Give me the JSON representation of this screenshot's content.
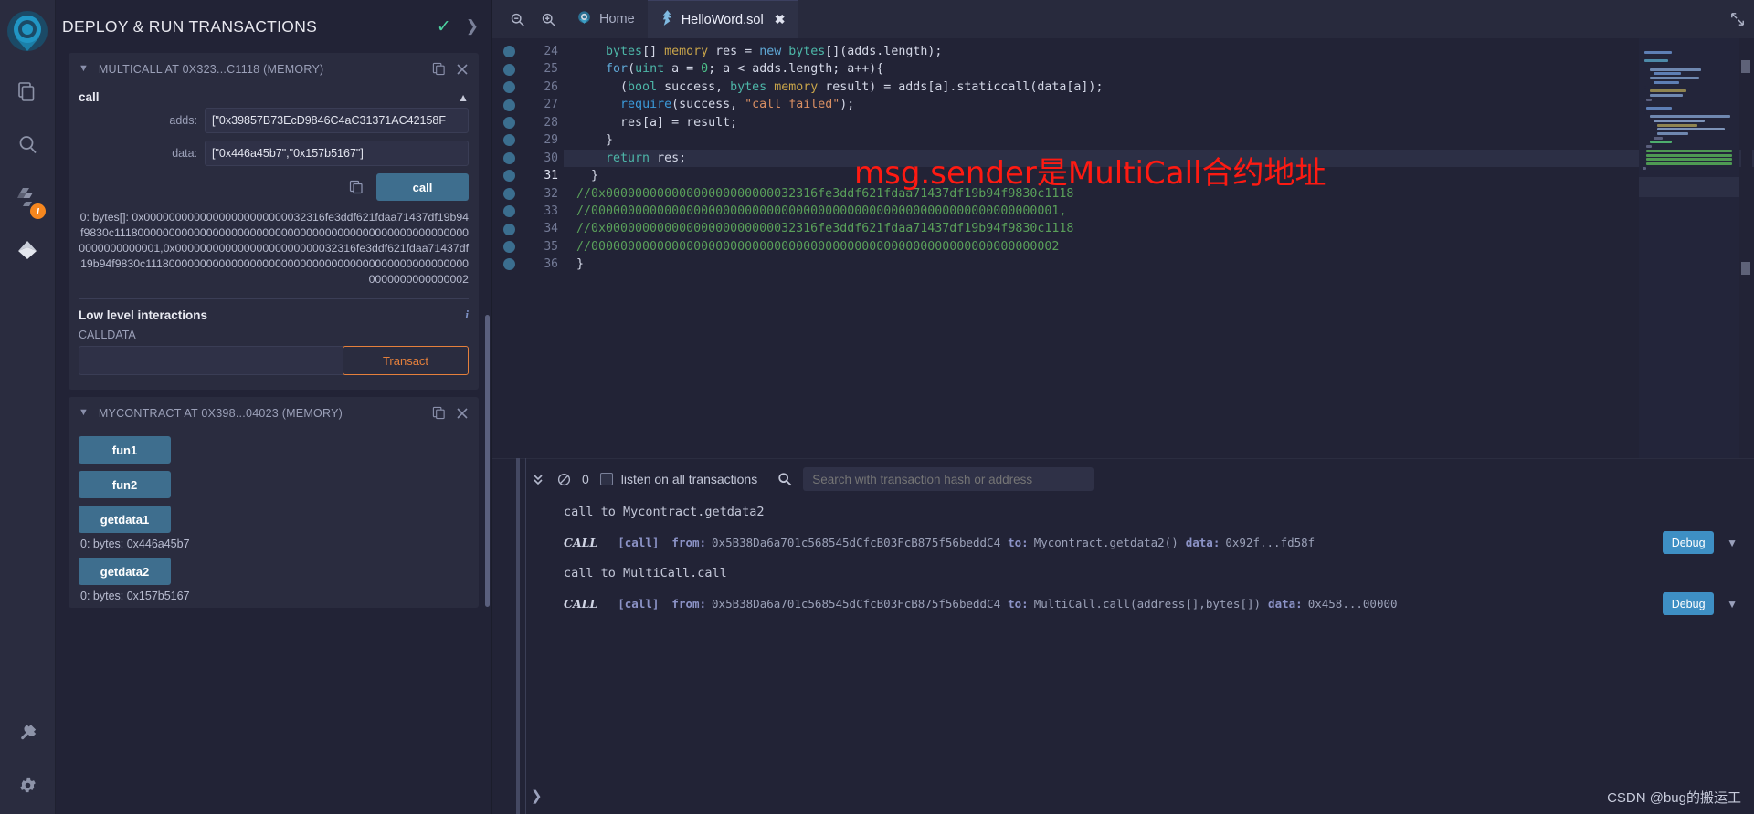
{
  "iconbar": {
    "items": [
      {
        "name": "remix-logo",
        "label": "Remix"
      },
      {
        "name": "file-explorer-icon",
        "label": "File explorer"
      },
      {
        "name": "search-icon",
        "label": "Search in files"
      },
      {
        "name": "solidity-compiler-icon",
        "label": "Solidity compiler",
        "badge": "1"
      },
      {
        "name": "deploy-run-icon",
        "label": "Deploy & run transactions"
      },
      {
        "name": "plugin-manager-icon",
        "label": "Plugin manager"
      },
      {
        "name": "settings-icon",
        "label": "Settings"
      }
    ]
  },
  "left_panel": {
    "title": "DEPLOY & RUN TRANSACTIONS",
    "header_check_icon": "check-icon",
    "header_chevron_icon": "chevron-right-icon",
    "contracts": [
      {
        "title": "MULTICALL AT 0X323...C1118 (MEMORY)",
        "copy_icon": "copy-icon",
        "close_icon": "close-icon",
        "function_name": "call",
        "args": [
          {
            "label": "adds:",
            "value": "[\"0x39857B73EcD9846C4aC31371AC42158F"
          },
          {
            "label": "data:",
            "value": "[\"0x446a45b7\",\"0x157b5167\"]"
          }
        ],
        "call_button": "call",
        "result_prefix": "0:",
        "result_type": "bytes[]:",
        "result_value": "0x00000000000000000000000032316fe3ddf621fdaa71437df19b94f9830c1118000000000000000000000000000000000000000000000000000000000000000001,0x00000000000000000000000032316fe3ddf621fdaa71437df19b94f9830c11180000000000000000000000000000000000000000000000000000000000000002",
        "low_level_title": "Low level interactions",
        "calldata_label": "CALLDATA",
        "calldata_value": "",
        "transact_button": "Transact",
        "info_icon": "info-icon"
      },
      {
        "title": "MYCONTRACT AT 0X398...04023 (MEMORY)",
        "copy_icon": "copy-icon",
        "close_icon": "close-icon",
        "buttons": [
          {
            "label": "fun1",
            "output": null
          },
          {
            "label": "fun2",
            "output": null
          },
          {
            "label": "getdata1",
            "output": "0: bytes: 0x446a45b7"
          },
          {
            "label": "getdata2",
            "output": "0: bytes: 0x157b5167"
          }
        ]
      }
    ]
  },
  "tabbar": {
    "zoom_out_icon": "zoom-out-icon",
    "zoom_in_icon": "zoom-in-icon",
    "tabs": [
      {
        "label": "Home",
        "icon": "remix-home-icon",
        "active": false,
        "closable": false
      },
      {
        "label": "HelloWord.sol",
        "icon": "solidity-file-icon",
        "active": true,
        "closable": true
      }
    ],
    "expand_icon": "expand-icon"
  },
  "editor": {
    "annotation": "msg.sender是MultiCall合约地址",
    "current_line": 31,
    "lines": [
      {
        "no": 24,
        "text": "    bytes[] memory res = new bytes[](adds.length);"
      },
      {
        "no": 25,
        "text": "    for(uint a = 0; a < adds.length; a++){"
      },
      {
        "no": 26,
        "text": "      (bool success, bytes memory result) = adds[a].staticcall(data[a]);"
      },
      {
        "no": 27,
        "text": "      require(success, \"call failed\");"
      },
      {
        "no": 28,
        "text": "      res[a] = result;"
      },
      {
        "no": 29,
        "text": "    }"
      },
      {
        "no": 30,
        "text": "    return res;"
      },
      {
        "no": 31,
        "text": "  }"
      },
      {
        "no": 32,
        "text": "//0x00000000000000000000000032316fe3ddf621fdaa71437df19b94f9830c1118"
      },
      {
        "no": 33,
        "text": "//0000000000000000000000000000000000000000000000000000000000000001,"
      },
      {
        "no": 34,
        "text": "//0x00000000000000000000000032316fe3ddf621fdaa71437df19b94f9830c1118"
      },
      {
        "no": 35,
        "text": "//0000000000000000000000000000000000000000000000000000000000000002"
      },
      {
        "no": 36,
        "text": "}"
      }
    ]
  },
  "terminal": {
    "collapse_icon": "chevron-double-down-icon",
    "clear_icon": "no-entry-icon",
    "pending_count": "0",
    "listen_label": "listen on all transactions",
    "listen_checked": false,
    "search_icon": "search-icon",
    "search_placeholder": "Search with transaction hash or address",
    "search_value": "",
    "entries": [
      {
        "kind": "plain",
        "text": "call to Mycontract.getdata2"
      },
      {
        "kind": "call",
        "badge": "CALL",
        "tag": "[call]",
        "from_label": "from:",
        "from": "0x5B38Da6a701c568545dCfcB03FcB875f56beddC4",
        "to_label": "to:",
        "to": "Mycontract.getdata2()",
        "data_label": "data:",
        "data": "0x92f...fd58f",
        "debug_button": "Debug",
        "caret_icon": "chevron-down-icon"
      },
      {
        "kind": "plain",
        "text": "call to MultiCall.call"
      },
      {
        "kind": "call",
        "badge": "CALL",
        "tag": "[call]",
        "from_label": "from:",
        "from": "0x5B38Da6a701c568545dCfcB03FcB875f56beddC4",
        "to_label": "to:",
        "to": "MultiCall.call(address[],bytes[])",
        "data_label": "data:",
        "data": "0x458...00000",
        "debug_button": "Debug",
        "caret_icon": "chevron-down-icon"
      }
    ],
    "prompt_icon": "chevron-right-icon",
    "watermark": "CSDN @bug的搬运工"
  },
  "colors": {
    "accent_blue": "#3e6e8e",
    "accent_orange": "#e5803c",
    "debug_blue": "#3e8fc4",
    "annotation_red": "#fe1a12",
    "badge_orange": "#f6871f"
  }
}
